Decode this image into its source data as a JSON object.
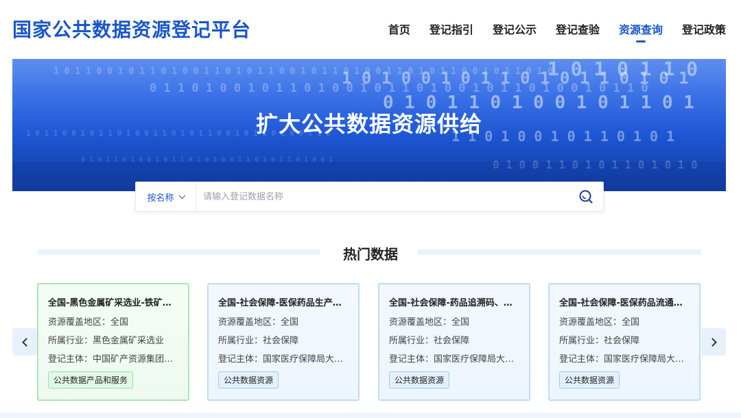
{
  "header": {
    "logo": "国家公共数据资源登记平台",
    "nav": [
      {
        "label": "首页",
        "active": false
      },
      {
        "label": "登记指引",
        "active": false
      },
      {
        "label": "登记公示",
        "active": false
      },
      {
        "label": "登记查验",
        "active": false
      },
      {
        "label": "资源查询",
        "active": true
      },
      {
        "label": "登记政策",
        "active": false
      }
    ]
  },
  "banner": {
    "title": "扩大公共数据资源供给"
  },
  "search": {
    "mode_label": "按名称",
    "placeholder": "请输入登记数据名称",
    "button_icon": "search-icon"
  },
  "hot": {
    "title": "热门数据",
    "cards": [
      {
        "title": "全国-黑色金属矿采选业-铁矿石...",
        "region": "资源覆盖地区：全国",
        "industry": "所属行业：黑色金属矿采选业",
        "subject": "登记主体：中国矿产资源集团大...",
        "tag": "公共数据产品和服务",
        "theme": "green"
      },
      {
        "title": "全国-社会保障-医保药品生产环...",
        "region": "资源覆盖地区：全国",
        "industry": "所属行业：社会保障",
        "subject": "登记主体：国家医疗保障局大数...",
        "tag": "公共数据资源",
        "theme": "blue"
      },
      {
        "title": "全国-社会保障-药品追溯码、医...",
        "region": "资源覆盖地区：全国",
        "industry": "所属行业：社会保障",
        "subject": "登记主体：国家医疗保障局大数...",
        "tag": "公共数据资源",
        "theme": "blue"
      },
      {
        "title": "全国-社会保障-医保药品流通环...",
        "region": "资源覆盖地区：全国",
        "industry": "所属行业：社会保障",
        "subject": "登记主体：国家医疗保障局大数...",
        "tag": "公共数据资源",
        "theme": "blue"
      }
    ]
  },
  "colors": {
    "brand": "#1a56c9",
    "banner_dark": "#123c9e",
    "card_border_blue": "#bfdcf5",
    "card_border_green": "#a9e7b5"
  }
}
